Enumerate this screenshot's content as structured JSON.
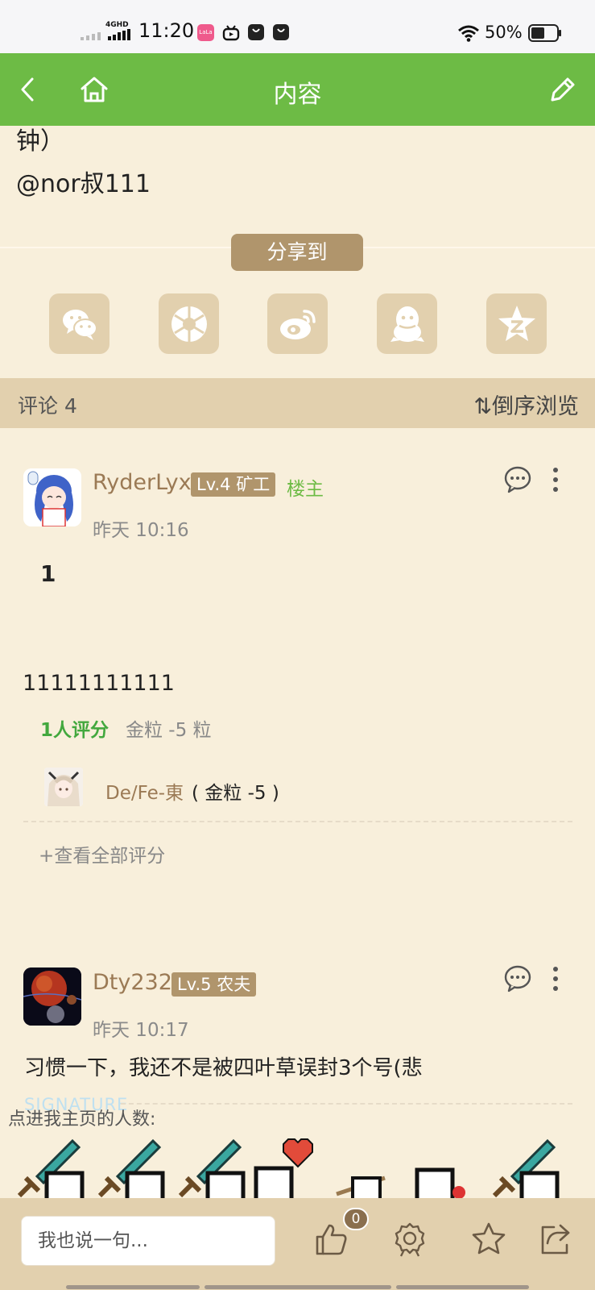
{
  "status_bar": {
    "network": "4GHD",
    "time": "11:20",
    "battery": "50%",
    "app_badge": "LaLa"
  },
  "header": {
    "title": "内容"
  },
  "post": {
    "tail_line1": "钟）",
    "tail_line2": "@nor叔111"
  },
  "share": {
    "label": "分享到",
    "targets": [
      "wechat-icon",
      "moments-icon",
      "weibo-icon",
      "qq-icon",
      "qzone-icon"
    ]
  },
  "comments_header": {
    "count_label": "评论 4",
    "sort_label": "⇅倒序浏览"
  },
  "comments": [
    {
      "username": "RyderLyx",
      "level": "Lv.4 矿工",
      "op_tag": "楼主",
      "time": "昨天 10:16",
      "body_bold": "1",
      "body": "11111111111",
      "rating": {
        "count_label": "1人评分",
        "summary": "金粒 -5 粒",
        "raters": [
          {
            "name": "De/Fe-東",
            "detail": "( 金粒 -5 )"
          }
        ],
        "view_all": "+查看全部评分"
      }
    },
    {
      "username": "Dty232",
      "level": "Lv.5 农夫",
      "time": "昨天 10:17",
      "body": "习惯一下，我还不是被四叶草误封3个号(悲",
      "signature_tag": "SIGNATURE",
      "signature_label": "点进我主页的人数:"
    }
  ],
  "bottom_bar": {
    "input_placeholder": "我也说一句...",
    "like_count": "0"
  },
  "colors": {
    "header": "#6dbb45",
    "background": "#f8efdb",
    "accent_tan": "#b0956c",
    "bar_tan": "#e2d0ae",
    "username": "#9b7a55",
    "op_green": "#6dbb45"
  }
}
